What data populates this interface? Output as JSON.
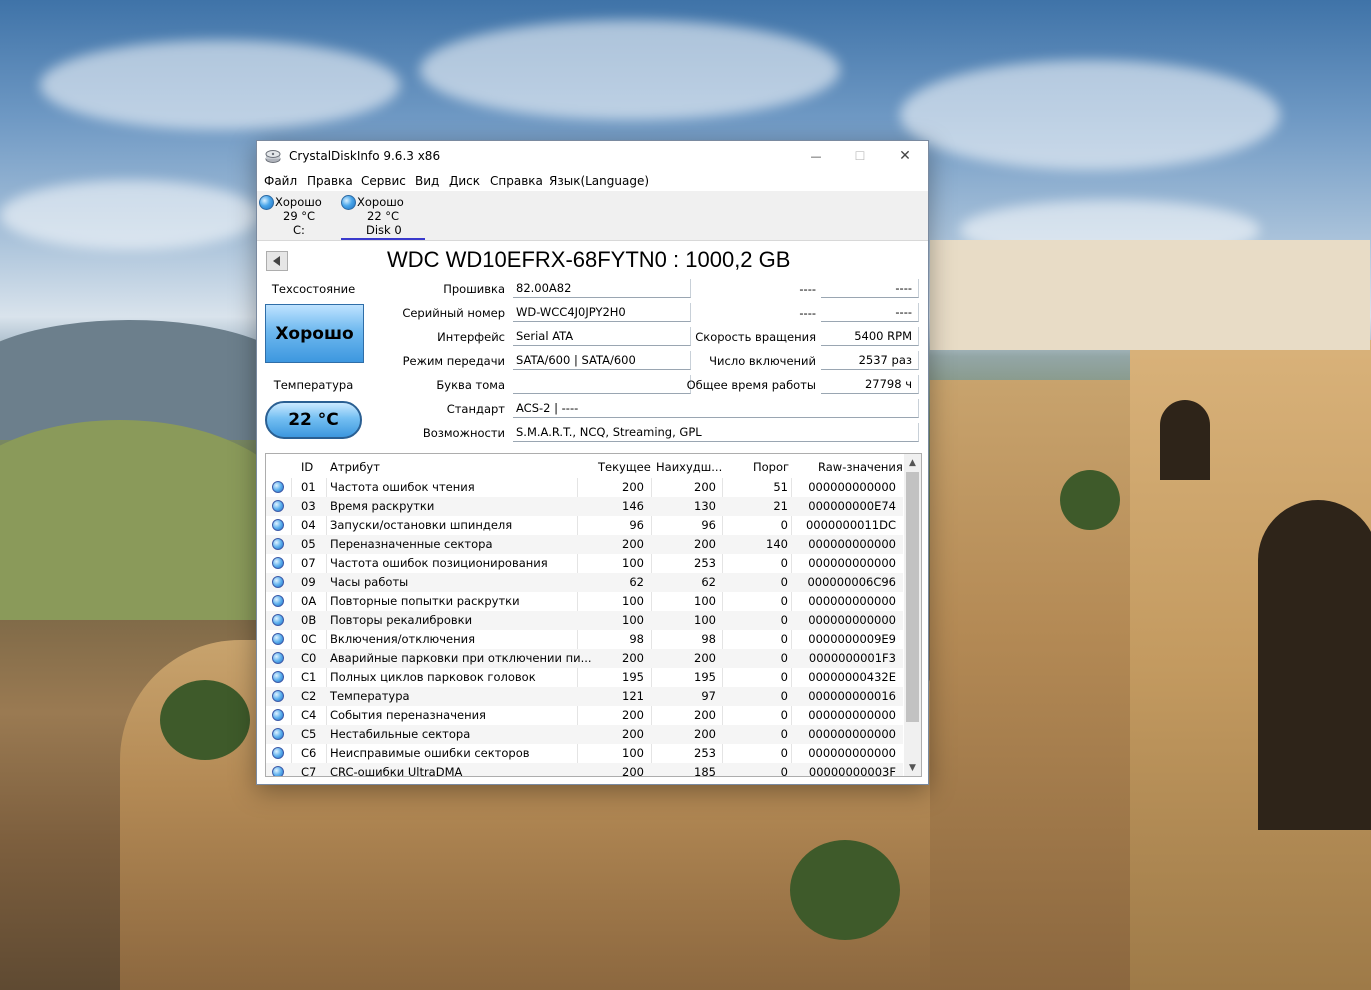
{
  "window": {
    "title": "CrystalDiskInfo 9.6.3 x86",
    "minimize": "—",
    "maximize": "☐",
    "close": "✕"
  },
  "menu": [
    "Файл",
    "Правка",
    "Сервис",
    "Вид",
    "Диск",
    "Справка",
    "Язык(Language)"
  ],
  "disks": [
    {
      "status": "Хорошо",
      "temp": "29 °C",
      "name": "C:"
    },
    {
      "status": "Хорошо",
      "temp": "22 °C",
      "name": "Disk 0"
    }
  ],
  "model": "WDC WD10EFRX-68FYTN0 : 1000,2 GB",
  "health": {
    "label": "Техсостояние",
    "value": "Хорошо"
  },
  "temperature": {
    "label": "Температура",
    "value": "22 °C"
  },
  "info_left": [
    {
      "label": "Прошивка",
      "value": "82.00A82"
    },
    {
      "label": "Серийный номер",
      "value": "WD-WCC4J0JPY2H0"
    },
    {
      "label": "Интерфейс",
      "value": "Serial ATA"
    },
    {
      "label": "Режим передачи",
      "value": "SATA/600 | SATA/600"
    },
    {
      "label": "Буква тома",
      "value": ""
    },
    {
      "label": "Стандарт",
      "value": "ACS-2 | ----"
    },
    {
      "label": "Возможности",
      "value": "S.M.A.R.T., NCQ, Streaming, GPL"
    }
  ],
  "info_right": [
    {
      "label": "----",
      "value": "----"
    },
    {
      "label": "----",
      "value": "----"
    },
    {
      "label": "Скорость вращения",
      "value": "5400 RPM"
    },
    {
      "label": "Число включений",
      "value": "2537 раз"
    },
    {
      "label": "Общее время работы",
      "value": "27798 ч"
    }
  ],
  "smart": {
    "headers": [
      "ID",
      "Атрибут",
      "Текущее",
      "Наихудш...",
      "Порог",
      "Raw-значения"
    ],
    "rows": [
      [
        "01",
        "Частота ошибок чтения",
        "200",
        "200",
        "51",
        "000000000000"
      ],
      [
        "03",
        "Время раскрутки",
        "146",
        "130",
        "21",
        "000000000E74"
      ],
      [
        "04",
        "Запуски/остановки шпинделя",
        "96",
        "96",
        "0",
        "0000000011DC"
      ],
      [
        "05",
        "Переназначенные сектора",
        "200",
        "200",
        "140",
        "000000000000"
      ],
      [
        "07",
        "Частота ошибок позиционирования",
        "100",
        "253",
        "0",
        "000000000000"
      ],
      [
        "09",
        "Часы работы",
        "62",
        "62",
        "0",
        "000000006C96"
      ],
      [
        "0A",
        "Повторные попытки раскрутки",
        "100",
        "100",
        "0",
        "000000000000"
      ],
      [
        "0B",
        "Повторы рекалибровки",
        "100",
        "100",
        "0",
        "000000000000"
      ],
      [
        "0C",
        "Включения/отключения",
        "98",
        "98",
        "0",
        "0000000009E9"
      ],
      [
        "C0",
        "Аварийные парковки при отключении пи...",
        "200",
        "200",
        "0",
        "0000000001F3"
      ],
      [
        "C1",
        "Полных циклов парковок головок",
        "195",
        "195",
        "0",
        "00000000432E"
      ],
      [
        "C2",
        "Температура",
        "121",
        "97",
        "0",
        "000000000016"
      ],
      [
        "C4",
        "События переназначения",
        "200",
        "200",
        "0",
        "000000000000"
      ],
      [
        "C5",
        "Нестабильные сектора",
        "200",
        "200",
        "0",
        "000000000000"
      ],
      [
        "C6",
        "Неисправимые ошибки секторов",
        "100",
        "253",
        "0",
        "000000000000"
      ],
      [
        "C7",
        "CRC-ошибки UltraDMA",
        "200",
        "185",
        "0",
        "00000000003F"
      ]
    ]
  }
}
